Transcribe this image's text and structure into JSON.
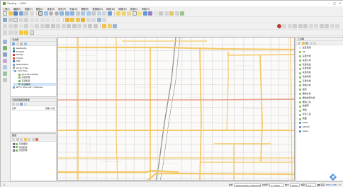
{
  "window": {
    "title": "Tianjing — QGIS"
  },
  "menu": [
    "工程(J)",
    "编辑(E)",
    "视图(V)",
    "图层(L)",
    "设置(S)",
    "插件(P)",
    "矢量(O)",
    "栅格(R)",
    "数据库(D)",
    "网络(W)",
    "网格(M)",
    "处理(C)",
    "帮助(H)"
  ],
  "colors": {
    "road_major": "#f3c96a",
    "road_major_outline": "#e2b45a",
    "road_highlight": "#e6a28a",
    "road_minor": "#d4d4d4",
    "railway": "#8a8a8a",
    "map_bg": "#fbfaf9"
  },
  "browser_panel": {
    "title": "浏览器",
    "items": [
      {
        "label": "SpatiaLite",
        "icon": "spatialite-icon"
      },
      {
        "label": "PostGIS",
        "icon": "postgis-icon"
      },
      {
        "label": "MSSQL",
        "icon": "mssql-icon"
      },
      {
        "label": "Oracle",
        "icon": "oracle-icon"
      },
      {
        "label": "DB2",
        "icon": "db2-icon"
      },
      {
        "label": "WMS/WMTS",
        "icon": "wms-icon"
      },
      {
        "label": "Vector Tiles",
        "icon": "vector-tiles-icon"
      },
      {
        "label": "XYZ Tiles",
        "icon": "xyz-tiles-icon"
      },
      {
        "label": "OpenStreetMap",
        "icon": "osm-icon"
      },
      {
        "label": "高德影像",
        "icon": "tile-icon"
      },
      {
        "label": "高德街道",
        "icon": "tile-icon"
      },
      {
        "label": "高德路网",
        "icon": "tile-icon",
        "selected": true
      },
      {
        "label": "WFS / OGC API - Features",
        "icon": "wfs-icon"
      }
    ]
  },
  "processing_panel": {
    "title": "高程剖面图查看器",
    "col_left": "名称",
    "col_right": "高程(m)值"
  },
  "layers_panel": {
    "title": "图层",
    "items": [
      {
        "label": "高德路网",
        "checked": true
      },
      {
        "label": "高德街道",
        "checked": true
      },
      {
        "label": "高德影像",
        "checked": true
      }
    ]
  },
  "toolbox_panel": {
    "title": "工具箱",
    "items": [
      "最近使用",
      "3D",
      "矢量分析",
      "矢量几何",
      "矢量叠加",
      "矢量选择",
      "矢量创建",
      "矢量通用",
      "矢量表格",
      "网络分析",
      "插值",
      "栅格分析",
      "栅格地形分析",
      "栅格工具",
      "数据库",
      "网格",
      "文件工具",
      "制图",
      "GDAL",
      "GRASS",
      "SAGA"
    ]
  },
  "status": {
    "coordinate_label": "坐标",
    "coordinate": "13051252.9,4736123.4",
    "scale_label": "比例尺",
    "scale": "1:17452",
    "magnifier_label": "放大",
    "magnifier": "100%",
    "rotation_label": "旋转",
    "rotation": "0.0 °",
    "render_label": "渲染",
    "crs": "EPSG:3857"
  }
}
